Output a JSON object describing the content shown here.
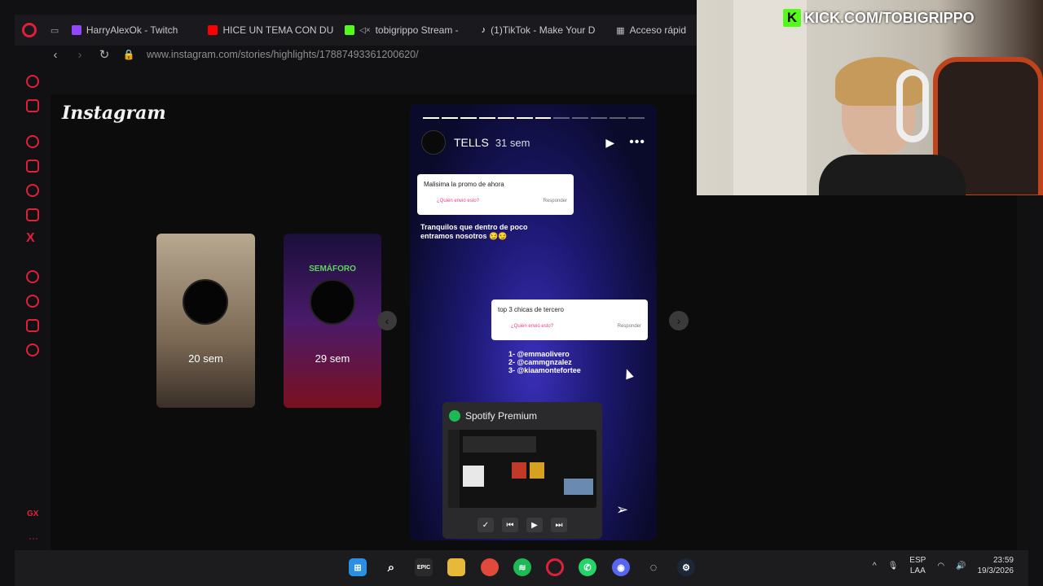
{
  "browser": {
    "tabs": [
      {
        "label": "HarryAlexOk - Twitch",
        "icon": "twitch-icon",
        "color": "#9146ff"
      },
      {
        "label": "HICE UN TEMA CON DU",
        "icon": "youtube-icon",
        "color": "#ff0000"
      },
      {
        "label": "tobigrippo Stream - ",
        "icon": "kick-icon",
        "color": "#53fc18"
      },
      {
        "label": "(1)TikTok - Make Your D",
        "icon": "tiktok-icon",
        "color": "#ffffff"
      },
      {
        "label": "Acceso rápid",
        "icon": "speed-dial-icon",
        "color": "#bbbbbb"
      }
    ],
    "url": "www.instagram.com/stories/highlights/17887493361200620/"
  },
  "instagram": {
    "logo": "Instagram",
    "thumbs": [
      {
        "age": "20 sem"
      },
      {
        "age": "29 sem",
        "title": "SEMÁFORO"
      }
    ],
    "story": {
      "user": "TELLS",
      "age": "31 sem",
      "segments_total": 12,
      "segments_done": 7,
      "card1_question": "Malisima la promo de ahora",
      "card1_who": "¿Quién envió esto?",
      "card1_reply": "Responder",
      "text1": "Tranquilos que dentro de poco entramos nosotros 😏😏",
      "card2_question": "top 3 chicas de tercero",
      "card2_who": "¿Quién envió esto?",
      "card2_reply": "Responder",
      "name1": "1- @emmaolivero",
      "name2": "2- @cammgnzalez",
      "name3": "3- @kiaamontefortee"
    }
  },
  "spotify_popup": {
    "title": "Spotify Premium"
  },
  "overlay": {
    "kick_text": "KICK.COM/TOBIGRIPPO"
  },
  "taskbar": {
    "lang_line1": "ESP",
    "lang_line2": "LAA",
    "time": "23:59",
    "date": "19/3/2026"
  },
  "colors": {
    "opera_red": "#e0203a",
    "kick_green": "#53fc18",
    "spotify_green": "#1db954"
  }
}
